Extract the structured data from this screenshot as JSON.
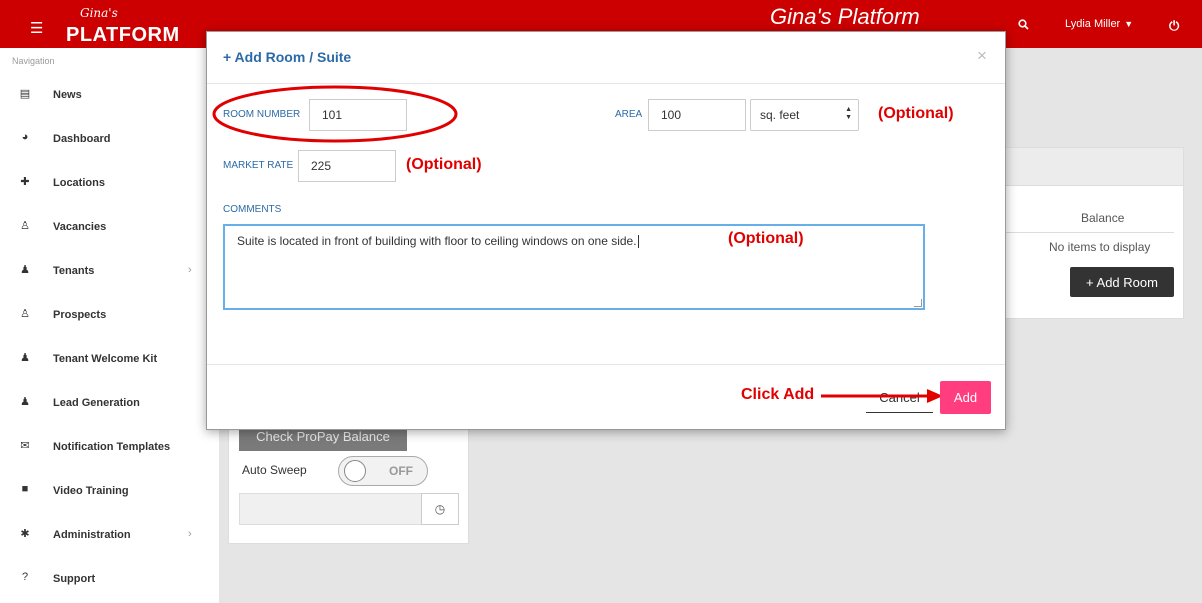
{
  "header": {
    "menu_icon": "hamburger-icon",
    "logo_script": "Gina's",
    "logo_text": "PLATFORM",
    "app_title": "Gina's Platform",
    "user_name": "Lydia Miller",
    "search_icon": "search-icon",
    "power_icon": "power-icon"
  },
  "sidebar": {
    "nav_label": "Navigation",
    "items": [
      {
        "label": "News",
        "icon": "newspaper-icon",
        "glyph": "▤"
      },
      {
        "label": "Dashboard",
        "icon": "dashboard-icon",
        "glyph": "◕"
      },
      {
        "label": "Locations",
        "icon": "pin-icon",
        "glyph": "✚"
      },
      {
        "label": "Vacancies",
        "icon": "user-outline-icon",
        "glyph": "♙"
      },
      {
        "label": "Tenants",
        "icon": "user-icon",
        "glyph": "♟",
        "has_arrow": true
      },
      {
        "label": "Prospects",
        "icon": "user-outline-icon",
        "glyph": "♙"
      },
      {
        "label": "Tenant Welcome Kit",
        "icon": "user-icon",
        "glyph": "♟"
      },
      {
        "label": "Lead Generation",
        "icon": "user-icon",
        "glyph": "♟"
      },
      {
        "label": "Notification Templates",
        "icon": "envelope-icon",
        "glyph": "✉"
      },
      {
        "label": "Video Training",
        "icon": "video-icon",
        "glyph": "■"
      },
      {
        "label": "Administration",
        "icon": "gear-icon",
        "glyph": "✱",
        "has_arrow": true
      },
      {
        "label": "Support",
        "icon": "question-icon",
        "glyph": "?"
      }
    ],
    "arrow_glyph": "›"
  },
  "background": {
    "balance_header": "Balance",
    "no_items": "No items to display",
    "add_room_label": "+ Add Room",
    "propay_label": "Check ProPay Balance",
    "auto_sweep_label": "Auto Sweep",
    "toggle_state": "OFF",
    "clock_icon": "clock-icon"
  },
  "modal": {
    "title": "+ Add Room / Suite",
    "close_glyph": "×",
    "room_number_label": "ROOM NUMBER",
    "room_number_value": "101",
    "area_label": "AREA",
    "area_value": "100",
    "area_unit": "sq. feet",
    "market_rate_label": "MARKET RATE",
    "market_rate_value": "225",
    "comments_label": "COMMENTS",
    "comments_value": "Suite is located in front of building with floor to ceiling windows on one side.",
    "cancel_label": "Cancel",
    "add_label": "Add"
  },
  "annotations": {
    "optional": "(Optional)",
    "click_add": "Click Add",
    "color": "#e00000"
  },
  "colors": {
    "brand_red": "#cc0000",
    "link_blue": "#2b6aa6",
    "add_pink": "#ff3d7f"
  }
}
